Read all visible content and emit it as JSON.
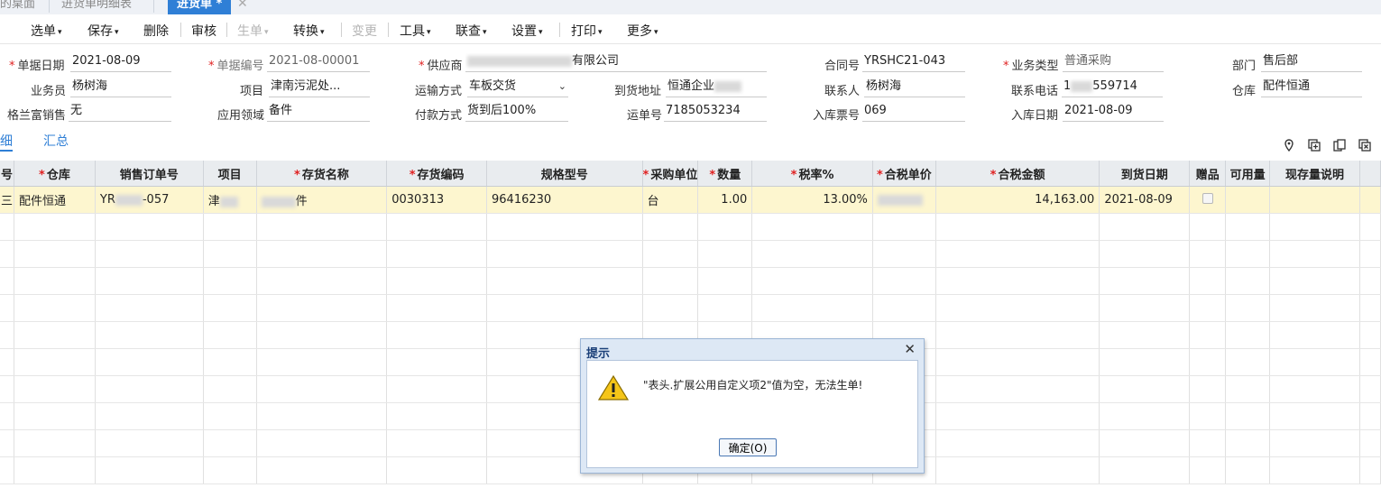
{
  "tabs": [
    {
      "label": "的桌面"
    },
    {
      "label": "进货单明细表"
    },
    {
      "label": "进货单 *"
    }
  ],
  "toolbar": {
    "select": "选单",
    "save": "保存",
    "delete": "删除",
    "audit": "审核",
    "generate": "生单",
    "convert": "转换",
    "change": "变更",
    "tools": "工具",
    "link": "联查",
    "settings": "设置",
    "print": "打印",
    "more": "更多"
  },
  "form": {
    "doc_date_label": "单据日期",
    "doc_date": "2021-08-09",
    "doc_no_label": "单据编号",
    "doc_no": "2021-08-00001",
    "supplier_label": "供应商",
    "supplier_suffix": "有限公司",
    "contract_label": "合同号",
    "contract": "YRSHC21-043",
    "biz_type_label": "业务类型",
    "biz_type": "普通采购",
    "dept_label": "部门",
    "dept": "售后部",
    "salesman_label": "业务员",
    "salesman": "杨树海",
    "project_label": "项目",
    "project": "津南污泥处...",
    "transport_label": "运输方式",
    "transport": "车板交货",
    "delivery_addr_label": "到货地址",
    "delivery_addr": "恒通企业",
    "contact_label": "联系人",
    "contact": "杨树海",
    "phone_label": "联系电话",
    "phone_prefix": "1",
    "phone_suffix": "559714",
    "warehouse_label": "仓库",
    "warehouse": "配件恒通",
    "glf_label": "格兰富销售",
    "glf": "无",
    "app_field_label": "应用领域",
    "app_field": "备件",
    "payment_label": "付款方式",
    "payment": "货到后100%",
    "waybill_label": "运单号",
    "waybill": "7185053234",
    "invoice_label": "入库票号",
    "invoice": "069",
    "in_date_label": "入库日期",
    "in_date": "2021-08-09"
  },
  "subtabs": {
    "detail": "细",
    "summary": "汇总"
  },
  "grid": {
    "headers": [
      {
        "label": "号",
        "req": false
      },
      {
        "label": "仓库",
        "req": true
      },
      {
        "label": "销售订单号",
        "req": false
      },
      {
        "label": "项目",
        "req": false
      },
      {
        "label": "存货名称",
        "req": true
      },
      {
        "label": "存货编码",
        "req": true
      },
      {
        "label": "规格型号",
        "req": false
      },
      {
        "label": "采购单位",
        "req": true
      },
      {
        "label": "数量",
        "req": true
      },
      {
        "label": "税率%",
        "req": true
      },
      {
        "label": "合税单价",
        "req": true
      },
      {
        "label": "合税金额",
        "req": true
      },
      {
        "label": "到货日期",
        "req": false
      },
      {
        "label": "赠品",
        "req": false
      },
      {
        "label": "可用量",
        "req": false
      },
      {
        "label": "现存量说明",
        "req": false
      }
    ],
    "row1": {
      "idx": "三",
      "warehouse": "配件恒通",
      "so_prefix": "YR",
      "so_suffix": "-057",
      "project": "津",
      "item_suffix": "件",
      "code": "0030313",
      "spec": "96416230",
      "unit": "台",
      "qty": "1.00",
      "tax": "13.00%",
      "price": "",
      "amount": "14,163.00",
      "arrive": "2021-08-09"
    }
  },
  "dialog": {
    "title": "提示",
    "message": "\"表头.扩展公用自定义项2\"值为空，无法生单!",
    "ok": "确定(O)"
  }
}
